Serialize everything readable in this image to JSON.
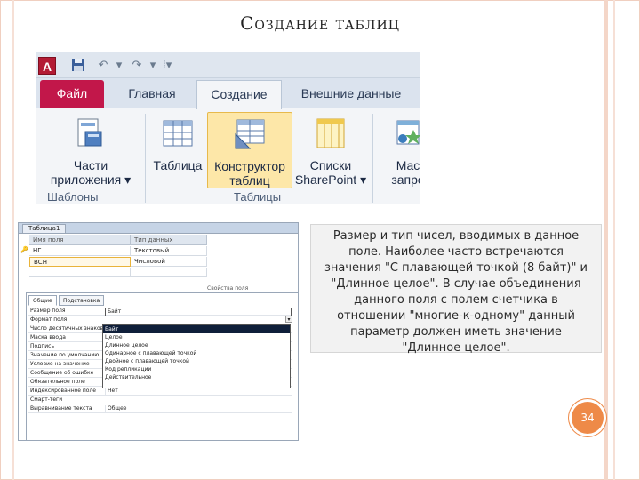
{
  "slide": {
    "title": "Создание таблиц",
    "page_number": "34"
  },
  "ribbon": {
    "app_logo": "A",
    "tabs": [
      {
        "label": "Файл"
      },
      {
        "label": "Главная"
      },
      {
        "label": "Создание"
      },
      {
        "label": "Внешние данные"
      }
    ],
    "active_tab": "Создание",
    "buttons": {
      "app_parts": {
        "line1": "Части",
        "line2": "приложения ▾"
      },
      "table": {
        "line1": "Таблица"
      },
      "table_design": {
        "line1": "Конструктор",
        "line2": "таблиц"
      },
      "sharepoint_lists": {
        "line1": "Списки",
        "line2": "SharePoint ▾"
      },
      "query_wizard": {
        "line1": "Мас",
        "line2": "запро"
      }
    },
    "groups": {
      "templates": "Шаблоны",
      "tables": "Таблицы"
    },
    "colors": {
      "file_tab": "#c2174a",
      "highlight": "#fde7a8"
    }
  },
  "design_view": {
    "tab_name": "Таблица1",
    "grid_headers": {
      "field_name": "Имя поля",
      "data_type": "Тип данных"
    },
    "rows": [
      {
        "key": "🔑",
        "field": "НГ",
        "type": "Текстовый"
      },
      {
        "key": "",
        "field": "ВСН",
        "type": "Числовой"
      }
    ],
    "props_caption": "Свойства поля",
    "props_tabs": {
      "general": "Общие",
      "lookup": "Подстановка"
    },
    "properties": [
      {
        "name": "Размер поля",
        "value": "Байт"
      },
      {
        "name": "Формат поля",
        "value": ""
      },
      {
        "name": "Число десятичных знаков",
        "value": ""
      },
      {
        "name": "Маска ввода",
        "value": ""
      },
      {
        "name": "Подпись",
        "value": ""
      },
      {
        "name": "Значение по умолчанию",
        "value": ""
      },
      {
        "name": "Условие на значение",
        "value": ""
      },
      {
        "name": "Сообщение об ошибке",
        "value": ""
      },
      {
        "name": "Обязательное поле",
        "value": "Нет"
      },
      {
        "name": "Индексированное поле",
        "value": "Нет"
      },
      {
        "name": "Смарт-теги",
        "value": ""
      },
      {
        "name": "Выравнивание текста",
        "value": "Общее"
      }
    ],
    "dropdown_options": [
      "Байт",
      "Целое",
      "Длинное целое",
      "Одинарное с плавающей точкой",
      "Двойное с плавающей точкой",
      "Код репликации",
      "Действительное"
    ],
    "dropdown_selected": "Байт"
  },
  "help_text": "Размер и тип чисел, вводимых в данное поле. Наиболее часто встречаются значения \"С плавающей точкой (8 байт)\" и \"Длинное целое\". В случае объединения данного поля с полем счетчика в отношении \"многие-к-одному\" данный параметр должен иметь значение \"Длинное целое\"."
}
